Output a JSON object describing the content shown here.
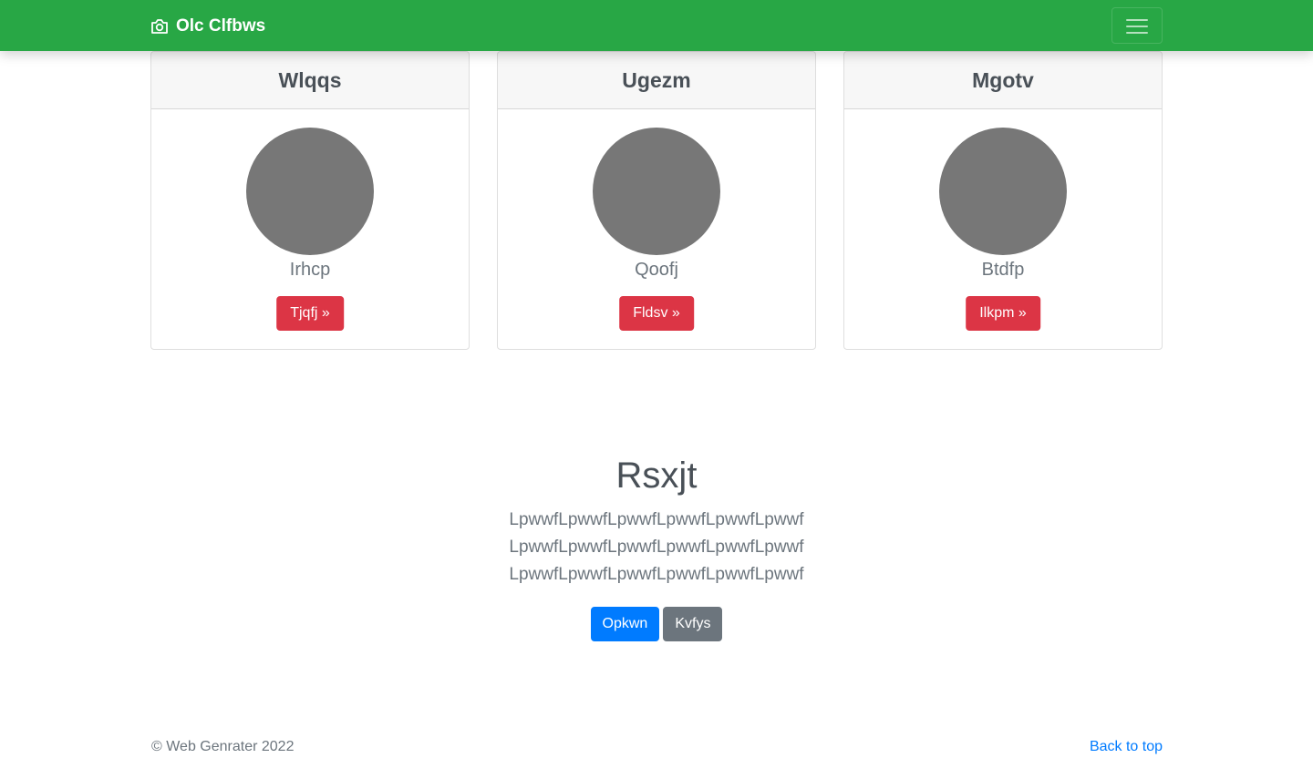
{
  "navbar": {
    "brand_text": "Olc Clfbws",
    "brand_icon": "camera-icon",
    "toggler_icon": "hamburger-icon",
    "background_color": "#28a745"
  },
  "cards": [
    {
      "title": "Wlqqs",
      "name": "Irhcp",
      "button_label": "Tjqfj »"
    },
    {
      "title": "Ugezm",
      "name": "Qoofj",
      "button_label": "Fldsv »"
    },
    {
      "title": "Mgotv",
      "name": "Btdfp",
      "button_label": "Ilkpm »"
    }
  ],
  "hero": {
    "title": "Rsxjt",
    "lines": [
      "LpwwfLpwwfLpwwfLpwwfLpwwfLpwwf",
      "LpwwfLpwwfLpwwfLpwwfLpwwfLpwwf",
      "LpwwfLpwwfLpwwfLpwwfLpwwfLpwwf"
    ],
    "primary_button": "Opkwn",
    "secondary_button": "Kvfys"
  },
  "footer": {
    "copyright": "© Web Genrater 2022",
    "back_to_top": "Back to top"
  },
  "colors": {
    "card_button": "#dc3545",
    "primary": "#007bff",
    "secondary": "#6c757d",
    "avatar": "#777777"
  }
}
